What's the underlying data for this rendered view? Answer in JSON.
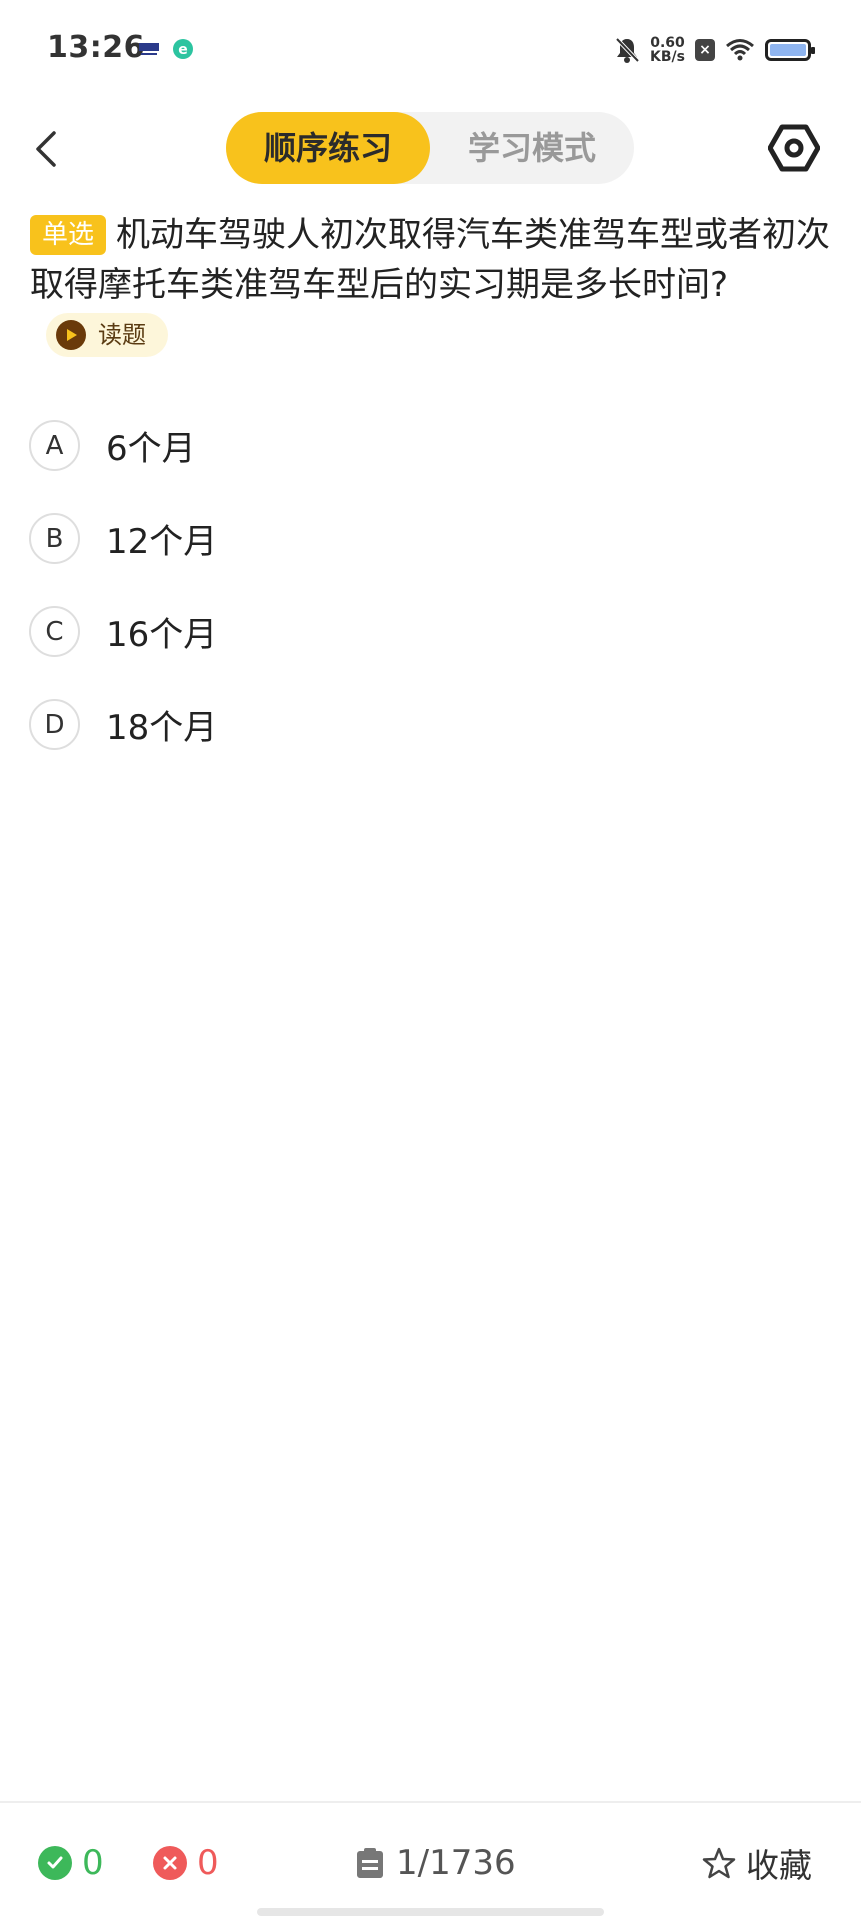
{
  "status_bar": {
    "time": "13:26",
    "net_speed_value": "0.60",
    "net_speed_unit": "KB/s",
    "icons": [
      "mute-icon",
      "close-box-icon",
      "wifi-icon",
      "battery-icon"
    ]
  },
  "header": {
    "tabs": [
      {
        "label": "顺序练习",
        "active": true
      },
      {
        "label": "学习模式",
        "active": false
      }
    ]
  },
  "question": {
    "type_badge": "单选",
    "text": "机动车驾驶人初次取得汽车类准驾车型或者初次取得摩托车类准驾车型后的实习期是多长时间?",
    "read_label": "读题"
  },
  "options": [
    {
      "letter": "A",
      "text": "6个月"
    },
    {
      "letter": "B",
      "text": "12个月"
    },
    {
      "letter": "C",
      "text": "16个月"
    },
    {
      "letter": "D",
      "text": "18个月"
    }
  ],
  "bottom_bar": {
    "correct_count": "0",
    "wrong_count": "0",
    "progress": "1/1736",
    "favorite_label": "收藏"
  },
  "colors": {
    "accent": "#f8c21c",
    "correct": "#3db85a",
    "wrong": "#ef5a5a"
  }
}
